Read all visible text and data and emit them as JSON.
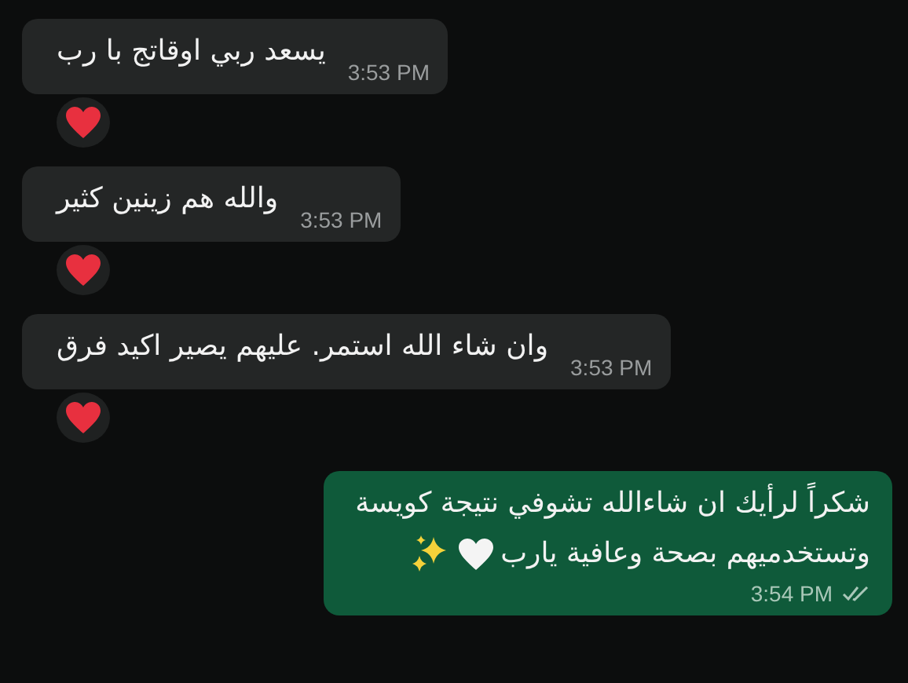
{
  "messages": [
    {
      "kind": "incoming",
      "lines": [
        "يسعد ربي اوقاتج با رب"
      ],
      "time": "3:53 PM",
      "reacted": true
    },
    {
      "kind": "incoming",
      "lines": [
        "والله هم زينين كثير"
      ],
      "time": "3:53 PM",
      "reacted": true
    },
    {
      "kind": "incoming",
      "lines": [
        "وان شاء الله استمر. عليهم يصير اكيد فرق"
      ],
      "time": "3:53 PM",
      "reacted": true
    },
    {
      "kind": "outgoing",
      "lines": [
        "شكراً لرأيك ان شاءالله تشوفي نتيجة كويسة",
        "وتستخدميهم بصحة وعافية يارب"
      ],
      "emoji": [
        {
          "kind": "white_heart"
        },
        {
          "kind": "sparkles"
        }
      ],
      "time": "3:54 PM",
      "read": false
    }
  ]
}
